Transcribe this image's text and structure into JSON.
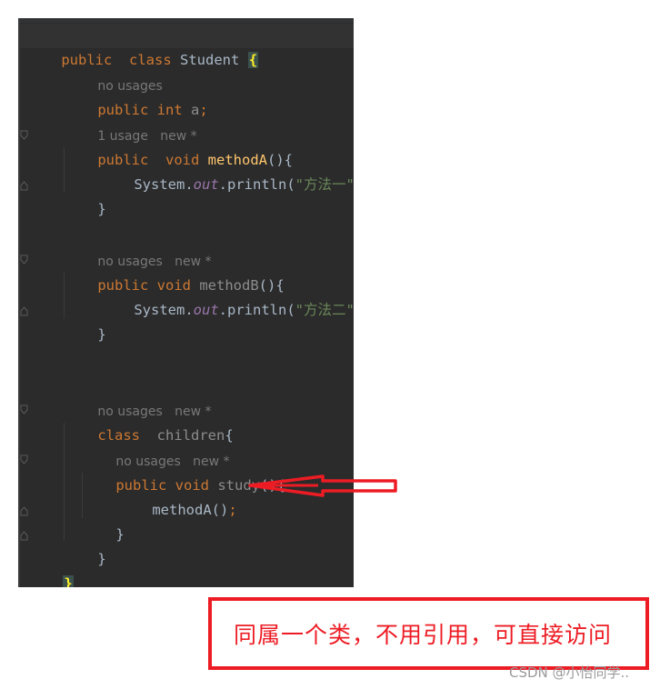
{
  "editor": {
    "lines": [
      {
        "kind": "code",
        "tokens": {
          "k1": "public",
          "k2": "class",
          "name": "Student",
          "brace": "{"
        }
      },
      {
        "kind": "hint",
        "text": "no usages"
      },
      {
        "kind": "code",
        "tokens": {
          "k1": "public",
          "k2": "int",
          "name": "a",
          "semi": ";"
        }
      },
      {
        "kind": "hint",
        "text": "1 usage   new *"
      },
      {
        "kind": "code",
        "tokens": {
          "k1": "public",
          "k2": "void",
          "name": "methodA",
          "rest": "(){"
        }
      },
      {
        "kind": "code",
        "tokens": {
          "obj": "System",
          "dot1": ".",
          "field": "out",
          "dot2": ".println(",
          "str": "\"方法一\"",
          "close": ")",
          "semi": ";"
        }
      },
      {
        "kind": "code",
        "tokens": {
          "brace": "}"
        }
      },
      {
        "kind": "hint",
        "text": "no usages   new *"
      },
      {
        "kind": "code",
        "tokens": {
          "k1": "public",
          "k2": "void",
          "name": "methodB",
          "rest": "(){"
        }
      },
      {
        "kind": "code",
        "tokens": {
          "obj": "System",
          "dot1": ".",
          "field": "out",
          "dot2": ".println(",
          "str": "\"方法二\"",
          "close": ")",
          "semi": ";"
        }
      },
      {
        "kind": "code",
        "tokens": {
          "brace": "}"
        }
      },
      {
        "kind": "hint",
        "text": "no usages   new *"
      },
      {
        "kind": "code",
        "tokens": {
          "k1": "class",
          "name": "children",
          "brace": "{"
        }
      },
      {
        "kind": "hint",
        "text": "no usages   new *"
      },
      {
        "kind": "code",
        "tokens": {
          "k1": "public",
          "k2": "void",
          "name": "study",
          "rest": "(){"
        }
      },
      {
        "kind": "code",
        "tokens": {
          "call": "methodA()",
          "semi": ";"
        }
      },
      {
        "kind": "code",
        "tokens": {
          "brace": "}"
        }
      },
      {
        "kind": "code",
        "tokens": {
          "brace": "}"
        }
      },
      {
        "kind": "code",
        "tokens": {
          "brace": "}"
        }
      }
    ]
  },
  "annotation": {
    "note": "同属一个类，不用引用，可直接访问",
    "arrow_color": "#ed1c24",
    "box_color": "#ed1c24"
  },
  "watermark": "CSDN @小怡同学.."
}
